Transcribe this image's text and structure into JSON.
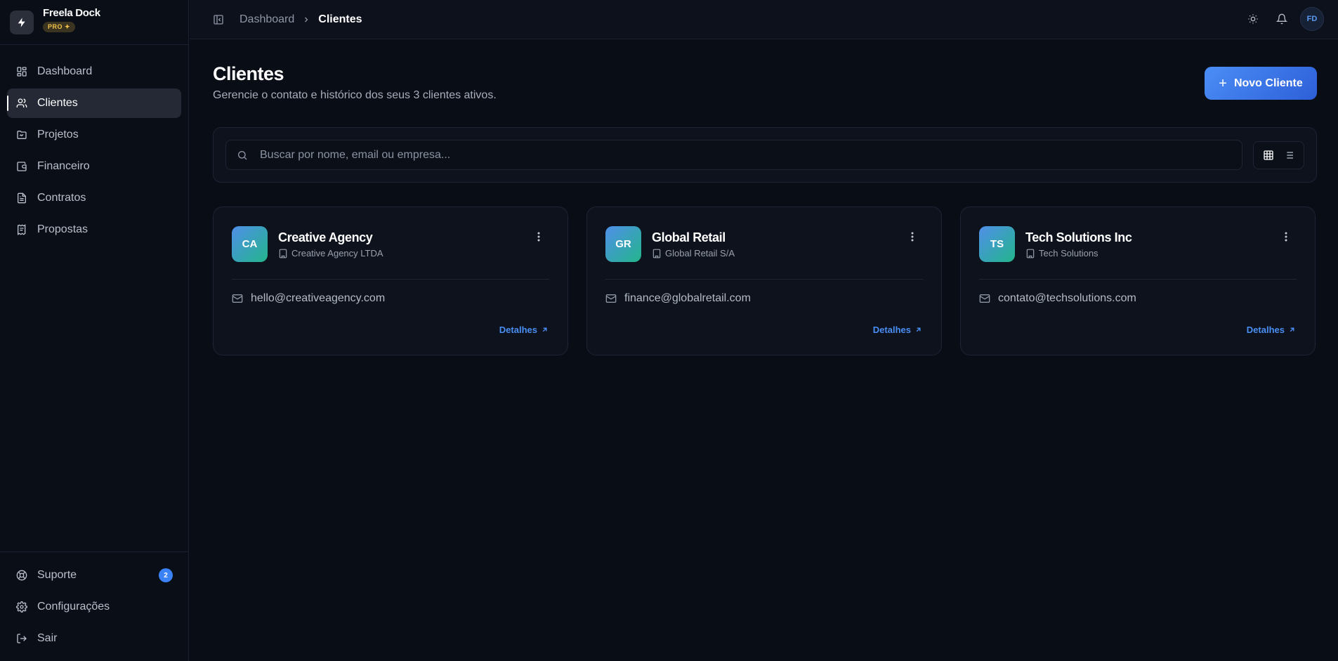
{
  "app": {
    "name": "Freela Dock",
    "badge": "PRO ✦"
  },
  "sidebar": {
    "items": [
      {
        "label": "Dashboard",
        "icon": "dashboard-icon",
        "active": false
      },
      {
        "label": "Clientes",
        "icon": "users-icon",
        "active": true
      },
      {
        "label": "Projetos",
        "icon": "folder-icon",
        "active": false
      },
      {
        "label": "Financeiro",
        "icon": "wallet-icon",
        "active": false
      },
      {
        "label": "Contratos",
        "icon": "file-text-icon",
        "active": false
      },
      {
        "label": "Propostas",
        "icon": "receipt-icon",
        "active": false
      }
    ],
    "bottom": [
      {
        "label": "Suporte",
        "icon": "lifebuoy-icon",
        "count": "2"
      },
      {
        "label": "Configurações",
        "icon": "gear-icon"
      },
      {
        "label": "Sair",
        "icon": "logout-icon"
      }
    ]
  },
  "header": {
    "breadcrumb_parent": "Dashboard",
    "breadcrumb_current": "Clientes",
    "avatar_initials": "FD"
  },
  "page": {
    "title": "Clientes",
    "subtitle": "Gerencie o contato e histórico dos seus 3 clientes ativos.",
    "new_button": "Novo Cliente"
  },
  "search": {
    "placeholder": "Buscar por nome, email ou empresa..."
  },
  "clients": [
    {
      "initials": "CA",
      "name": "Creative Agency",
      "company": "Creative Agency LTDA",
      "email": "hello@creativeagency.com",
      "details": "Detalhes"
    },
    {
      "initials": "GR",
      "name": "Global Retail",
      "company": "Global Retail S/A",
      "email": "finance@globalretail.com",
      "details": "Detalhes"
    },
    {
      "initials": "TS",
      "name": "Tech Solutions Inc",
      "company": "Tech Solutions",
      "email": "contato@techsolutions.com",
      "details": "Detalhes"
    }
  ],
  "colors": {
    "background": "#090d16",
    "accent": "#3b82f6",
    "pro_badge": "#f3c14a"
  }
}
